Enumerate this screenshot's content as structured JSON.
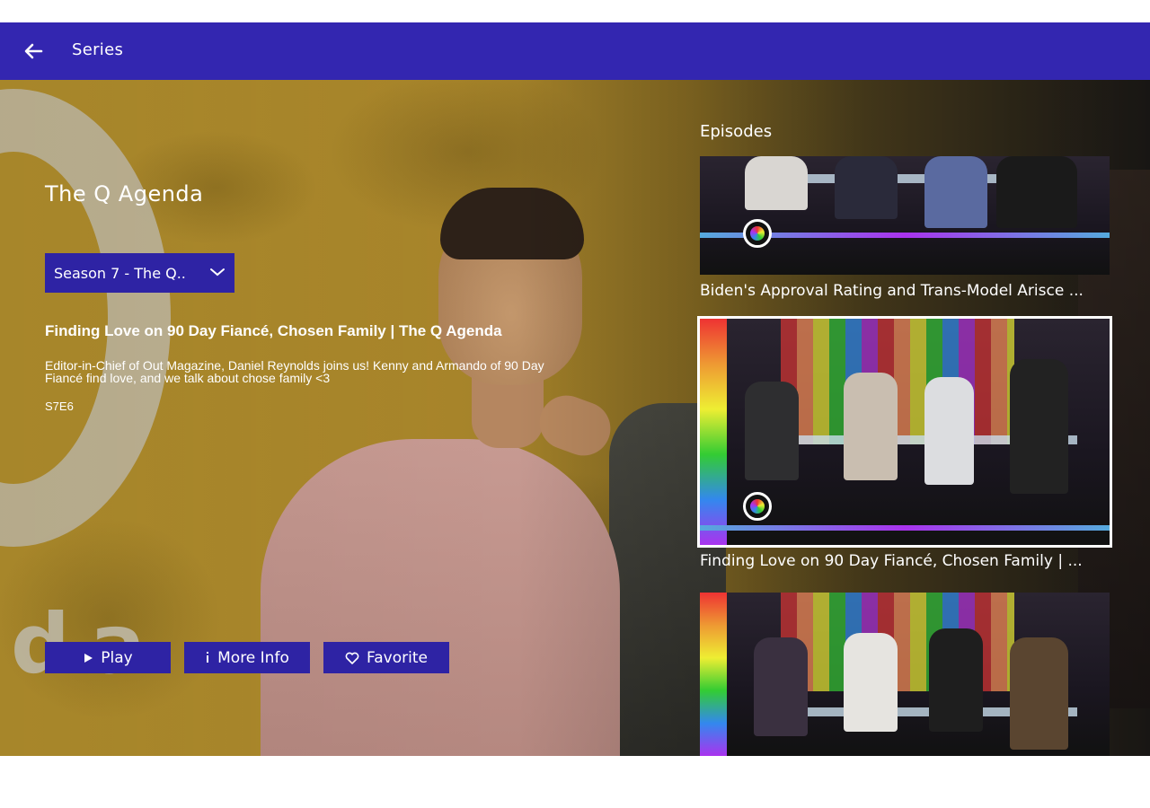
{
  "header": {
    "title": "Series"
  },
  "hero": {
    "show_title": "The Q Agenda",
    "logo_text": "da",
    "season_select": "Season 7 - The Q..",
    "episode_title": "Finding Love on 90 Day Fiancé, Chosen Family | The Q Agenda",
    "episode_description": "Editor-in-Chief of Out Magazine, Daniel Reynolds joins us! Kenny and Armando of 90 Day Fiancé find love, and we talk about chose family <3",
    "episode_code": "S7E6"
  },
  "actions": {
    "play": "Play",
    "more_info": "More Info",
    "favorite": "Favorite"
  },
  "episodes": {
    "heading": "Episodes",
    "items": [
      {
        "label": "Biden's Approval Rating and Trans-Model Ariscе ..."
      },
      {
        "label": "Finding Love on 90 Day Fiancé, Chosen Family | ..."
      },
      {
        "label": ""
      }
    ]
  },
  "colors": {
    "brand_bar": "#3326b0",
    "button_bg": "#2e23a4",
    "hero_bg": "#b08d2c"
  }
}
